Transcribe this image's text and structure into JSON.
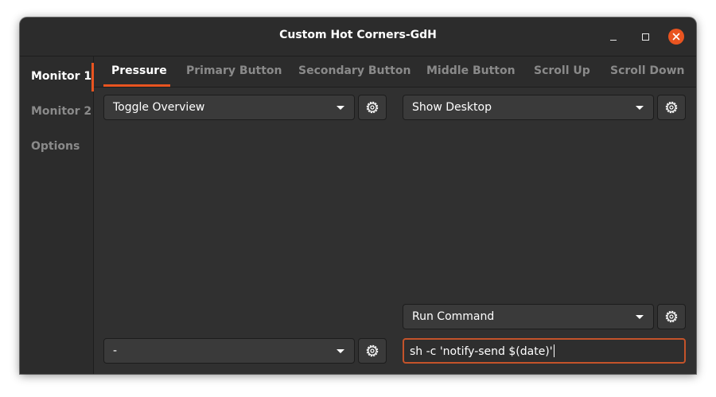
{
  "window": {
    "title": "Custom Hot Corners-GdH",
    "controls": [
      "minimize-icon",
      "maximize-icon",
      "close-icon"
    ]
  },
  "sidebar": {
    "items": [
      {
        "label": "Monitor 1",
        "active": true
      },
      {
        "label": "Monitor 2",
        "active": false
      },
      {
        "label": "Options",
        "active": false
      }
    ]
  },
  "tabs": [
    {
      "label": "Pressure",
      "active": true
    },
    {
      "label": "Primary Button",
      "active": false
    },
    {
      "label": "Secondary Button",
      "active": false
    },
    {
      "label": "Middle Button",
      "active": false
    },
    {
      "label": "Scroll Up",
      "active": false
    },
    {
      "label": "Scroll Down",
      "active": false
    }
  ],
  "corners": {
    "top_left": {
      "action": "Toggle Overview"
    },
    "top_right": {
      "action": "Show Desktop"
    },
    "bottom_left": {
      "action": "-"
    },
    "bottom_right": {
      "action": "Run Command",
      "command_value": "sh -c 'notify-send $(date)'"
    }
  },
  "colors": {
    "accent": "#e95420",
    "window_bg": "#303030",
    "button_bg": "#3a3a3a",
    "text": "#ffffff",
    "inactive_text": "#8a8a8a"
  },
  "icons": {
    "settings": "gear-icon",
    "dropdown": "chevron-down-icon"
  }
}
